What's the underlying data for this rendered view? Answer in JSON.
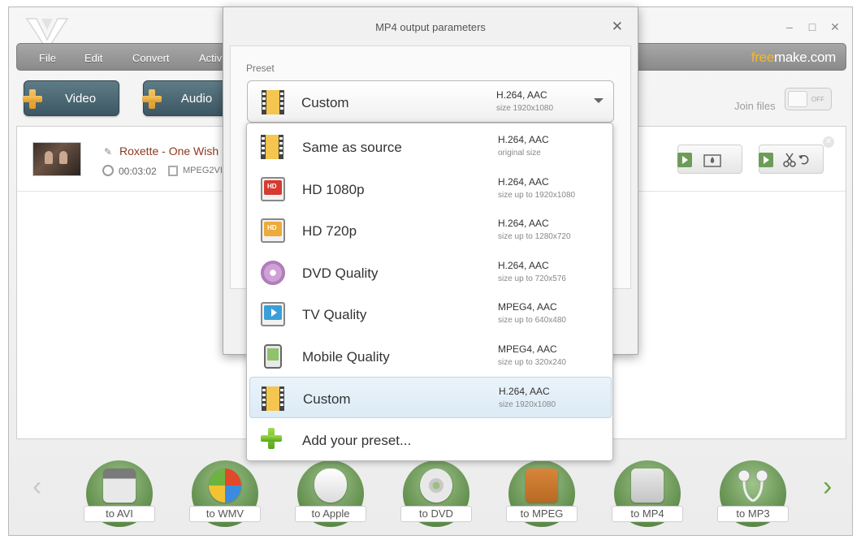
{
  "window": {
    "controls": [
      "–",
      "□",
      "✕"
    ]
  },
  "menu": {
    "items": [
      "File",
      "Edit",
      "Convert",
      "Activ"
    ],
    "brand_a": "free",
    "brand_b": "make.com"
  },
  "toolbar": {
    "video_label": "Video",
    "audio_label": "Audio",
    "join_label": "Join files",
    "join_state": "OFF"
  },
  "file": {
    "title": "Roxette - One Wish",
    "duration": "00:03:02",
    "codec": "MPEG2VIDE"
  },
  "dialog": {
    "title": "MP4 output parameters",
    "preset_label": "Preset",
    "selected": {
      "name": "Custom",
      "codec": "H.264, AAC",
      "size": "size 1920x1080"
    },
    "options": [
      {
        "name": "Same as source",
        "codec": "H.264, AAC",
        "size": "original size",
        "icon": "film-icon"
      },
      {
        "name": "HD 1080p",
        "codec": "H.264, AAC",
        "size": "size up to 1920x1080",
        "icon": "hd-monitor-red-icon"
      },
      {
        "name": "HD 720p",
        "codec": "H.264, AAC",
        "size": "size up to 1280x720",
        "icon": "hd-monitor-orange-icon"
      },
      {
        "name": "DVD Quality",
        "codec": "H.264, AAC",
        "size": "size up to 720x576",
        "icon": "disc-icon"
      },
      {
        "name": "TV Quality",
        "codec": "MPEG4, AAC",
        "size": "size up to 640x480",
        "icon": "tv-icon"
      },
      {
        "name": "Mobile Quality",
        "codec": "MPEG4, AAC",
        "size": "size up to 320x240",
        "icon": "mobile-icon"
      },
      {
        "name": "Custom",
        "codec": "H.264, AAC",
        "size": "size 1920x1080",
        "icon": "film-icon"
      },
      {
        "name": "Add your preset...",
        "icon": "plus-icon"
      }
    ],
    "hd_badge": "HD"
  },
  "formats": [
    "to AVI",
    "to WMV",
    "to Apple",
    "to DVD",
    "to MPEG",
    "to MP4",
    "to MP3"
  ],
  "colors": {
    "accent_green": "#5f8c4b",
    "brand_orange": "#f7b62d",
    "button_teal": "#3c5763",
    "selected_row": "#dcebf6"
  }
}
